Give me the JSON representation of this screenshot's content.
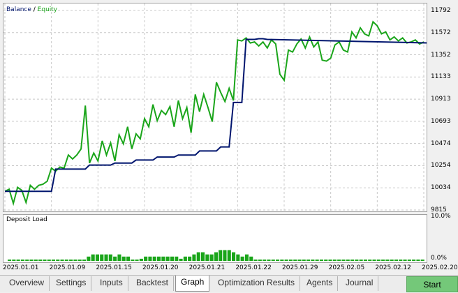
{
  "legend": {
    "balance": "Balance",
    "separator": " / ",
    "equity": "Equity"
  },
  "y_axis_ticks": [
    "11792",
    "11572",
    "11352",
    "11133",
    "10913",
    "10693",
    "10474",
    "10254",
    "10034",
    "9815"
  ],
  "load_panel": {
    "title": "Deposit Load",
    "top_tick": "10.0%",
    "bottom_tick": "0.0%"
  },
  "x_axis_ticks": [
    "2025.01.01",
    "2025.01.09",
    "2025.01.15",
    "2025.01.20",
    "2025.01.21",
    "2025.01.22",
    "2025.01.29",
    "2025.02.05",
    "2025.02.12",
    "2025.02.20"
  ],
  "tabs": [
    "Overview",
    "Settings",
    "Inputs",
    "Backtest",
    "Graph",
    "Optimization Results",
    "Agents",
    "Journal"
  ],
  "active_tab": "Graph",
  "start_button": "Start",
  "colors": {
    "balance": "#00156e",
    "equity": "#1aa51a",
    "load": "#1aa51a",
    "grid": "#c8c8c8",
    "start": "#74c879"
  },
  "chart_data": [
    {
      "type": "line",
      "title": "",
      "legend": [
        "Balance",
        "Equity"
      ],
      "ylim": [
        9815,
        11792
      ],
      "x_index_range": [
        0,
        99
      ],
      "series": [
        {
          "name": "Balance",
          "x": [
            0,
            11,
            12,
            19,
            20,
            25,
            26,
            30,
            31,
            35,
            36,
            40,
            41,
            45,
            46,
            50,
            51,
            53,
            54,
            56,
            57,
            59,
            60,
            61,
            62,
            100
          ],
          "y": [
            10000,
            10000,
            10220,
            10220,
            10260,
            10260,
            10280,
            10280,
            10310,
            10310,
            10340,
            10340,
            10360,
            10360,
            10400,
            10400,
            10440,
            10440,
            10880,
            10880,
            11505,
            11505,
            11512,
            11512,
            11505,
            11470
          ]
        },
        {
          "name": "Equity",
          "x": [
            0,
            1,
            2,
            3,
            4,
            5,
            6,
            7,
            8,
            9,
            10,
            11,
            12,
            13,
            14,
            15,
            16,
            17,
            18,
            19,
            20,
            21,
            22,
            23,
            24,
            25,
            26,
            27,
            28,
            29,
            30,
            31,
            32,
            33,
            34,
            35,
            36,
            37,
            38,
            39,
            40,
            41,
            42,
            43,
            44,
            45,
            46,
            47,
            48,
            49,
            50,
            51,
            52,
            53,
            54,
            55,
            56,
            57,
            58,
            59,
            60,
            61,
            62,
            63,
            64,
            65,
            66,
            67,
            68,
            69,
            70,
            71,
            72,
            73,
            74,
            75,
            76,
            77,
            78,
            79,
            80,
            81,
            82,
            83,
            84,
            85,
            86,
            87,
            88,
            89,
            90,
            91,
            92,
            93,
            94,
            95,
            96,
            97,
            98,
            99
          ],
          "y": [
            10000,
            10020,
            9880,
            10040,
            10010,
            9890,
            10060,
            10020,
            10060,
            10070,
            10100,
            10230,
            10200,
            10240,
            10230,
            10360,
            10320,
            10360,
            10420,
            10850,
            10280,
            10380,
            10300,
            10500,
            10360,
            10480,
            10300,
            10560,
            10470,
            10640,
            10420,
            10570,
            10520,
            10720,
            10640,
            10860,
            10700,
            10800,
            10760,
            10840,
            10640,
            10900,
            10720,
            10830,
            10580,
            10960,
            10790,
            10960,
            10830,
            10690,
            11080,
            10980,
            10890,
            11020,
            10900,
            11500,
            11490,
            11520,
            11470,
            11480,
            11440,
            11480,
            11420,
            11500,
            11460,
            11160,
            11100,
            11400,
            11380,
            11460,
            11510,
            11420,
            11530,
            11430,
            11480,
            11300,
            11290,
            11320,
            11450,
            11480,
            11400,
            11380,
            11580,
            11520,
            11620,
            11560,
            11540,
            11680,
            11640,
            11560,
            11580,
            11500,
            11530,
            11490,
            11520,
            11470,
            11480,
            11500,
            11460,
            11480
          ]
        }
      ]
    },
    {
      "type": "bar",
      "title": "Deposit Load",
      "ylim": [
        0,
        10
      ],
      "y_unit": "%",
      "values": [
        0.3,
        0.3,
        0.3,
        0.3,
        0.3,
        0.3,
        0.3,
        0.3,
        0.3,
        0.3,
        0.3,
        0.3,
        0.3,
        0.3,
        0.3,
        0.3,
        0.3,
        0.3,
        1,
        1.5,
        1.5,
        1.5,
        1.5,
        1.5,
        1,
        1.5,
        1,
        1,
        0.3,
        0.3,
        0.5,
        1,
        1,
        1,
        1,
        1,
        1,
        1,
        1,
        0.5,
        1,
        1,
        1.5,
        2,
        2,
        1.5,
        1.5,
        2,
        2.5,
        2.5,
        2.5,
        2,
        1.5,
        1,
        1.5,
        1,
        0.3,
        0.3,
        0.3,
        0.3,
        0.3,
        0.3,
        0.3,
        0.3,
        0.3,
        0.3,
        0.3,
        0.3,
        0.3,
        0.3,
        0.3,
        0.3,
        0.3,
        0.3,
        0.3,
        0.3,
        0.3,
        0.3,
        0.3,
        0.3,
        0.3,
        0.3,
        0.3,
        0.3,
        0.3,
        0.3,
        0.3,
        0.3,
        0.3,
        0.3,
        0.3,
        0.3,
        0.3,
        0.3,
        0.3
      ]
    }
  ]
}
